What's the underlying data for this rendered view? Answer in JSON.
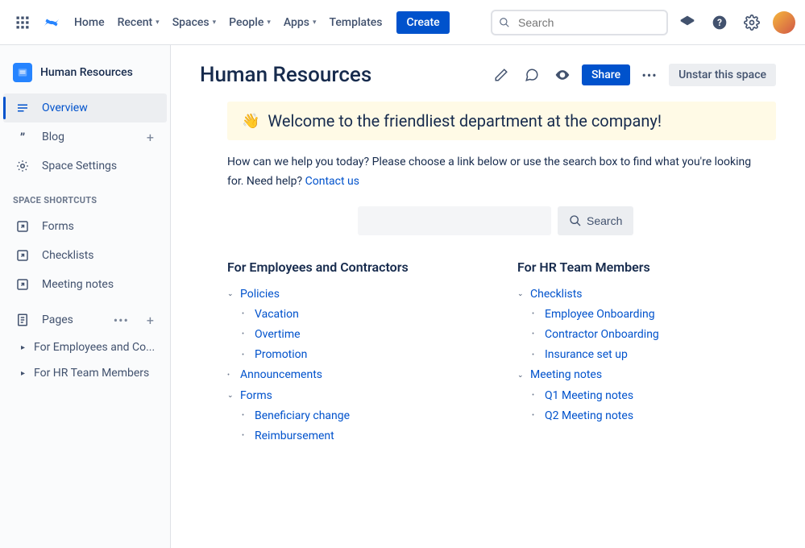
{
  "topbar": {
    "nav": [
      "Home",
      "Recent",
      "Spaces",
      "People",
      "Apps",
      "Templates"
    ],
    "nav_has_dropdown": [
      false,
      true,
      true,
      true,
      true,
      false
    ],
    "create_label": "Create",
    "search_placeholder": "Search"
  },
  "sidebar": {
    "space_name": "Human Resources",
    "overview_label": "Overview",
    "blog_label": "Blog",
    "settings_label": "Space Settings",
    "shortcuts_label": "SPACE SHORTCUTS",
    "shortcuts": [
      "Forms",
      "Checklists",
      "Meeting notes"
    ],
    "pages_label": "Pages",
    "tree": [
      {
        "label": "For Employees and Co..."
      },
      {
        "label": "For HR Team Members"
      }
    ]
  },
  "page": {
    "title": "Human Resources",
    "share_label": "Share",
    "unstar_label": "Unstar this space",
    "welcome": "Welcome to the friendliest department at the company!",
    "intro_pre": "How can we help you today? Please choose a link below or use the search box to find what you're looking for. Need help? ",
    "contact_label": "Contact us",
    "search_btn": "Search",
    "col1_title": "For Employees and Contractors",
    "col2_title": "For HR Team Members",
    "col1": [
      {
        "label": "Policies",
        "level": 1,
        "caret": true
      },
      {
        "label": "Vacation",
        "level": 2,
        "caret": false
      },
      {
        "label": "Overtime",
        "level": 2,
        "caret": false
      },
      {
        "label": "Promotion",
        "level": 2,
        "caret": false
      },
      {
        "label": "Announcements",
        "level": 1,
        "caret": false
      },
      {
        "label": "Forms",
        "level": 1,
        "caret": true
      },
      {
        "label": "Beneficiary change",
        "level": 2,
        "caret": false
      },
      {
        "label": "Reimbursement",
        "level": 2,
        "caret": false
      }
    ],
    "col2": [
      {
        "label": "Checklists",
        "level": 1,
        "caret": true
      },
      {
        "label": "Employee Onboarding",
        "level": 2,
        "caret": false
      },
      {
        "label": "Contractor Onboarding",
        "level": 2,
        "caret": false
      },
      {
        "label": "Insurance set up",
        "level": 2,
        "caret": false
      },
      {
        "label": "Meeting notes",
        "level": 1,
        "caret": true
      },
      {
        "label": "Q1 Meeting notes",
        "level": 2,
        "caret": false
      },
      {
        "label": "Q2 Meeting notes",
        "level": 2,
        "caret": false
      }
    ]
  }
}
